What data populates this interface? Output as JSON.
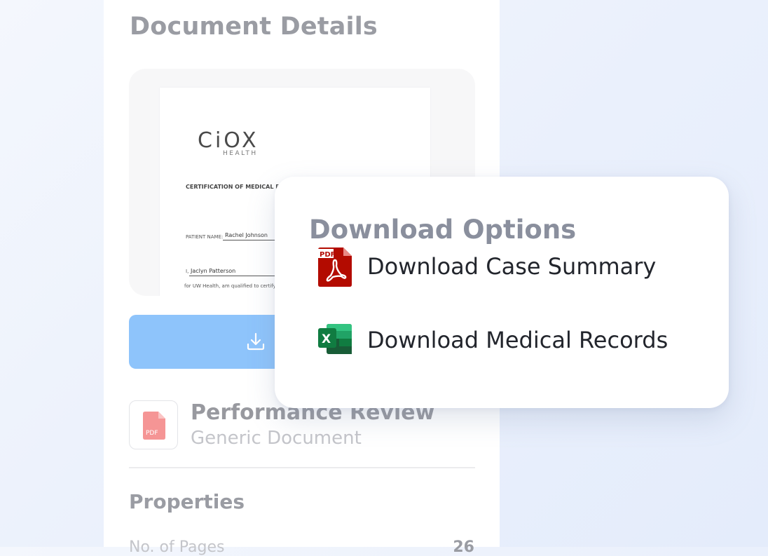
{
  "panel": {
    "title": "Document Details",
    "preview": {
      "logo": "CiOX",
      "logo_sub": "HEALTH",
      "cert_title": "CERTIFICATION OF MEDICAL RECORDS",
      "patient_label": "PATIENT NAME:",
      "patient_value": "Rachel Johnson",
      "sig_prefix": "I,",
      "sig_value": "Jaclyn Patterson",
      "footer_text": "for UW Health, am qualified to certify the"
    },
    "download_button_icon": "download-icon",
    "file": {
      "name": "Performance Review",
      "type": "Generic Document",
      "badge": "PDF"
    },
    "properties": {
      "title": "Properties",
      "rows": [
        {
          "label": "No. of Pages",
          "value": "26"
        }
      ]
    }
  },
  "popup": {
    "title": "Download Options",
    "options": [
      {
        "label": "Download Case Summary",
        "icon": "pdf-icon",
        "badge": "PDF"
      },
      {
        "label": "Download Medical Records",
        "icon": "excel-icon",
        "badge": "X"
      }
    ]
  },
  "colors": {
    "button": "#8ec4fb",
    "pdf_red": "#b30b00",
    "excel_green": "#107c41"
  }
}
